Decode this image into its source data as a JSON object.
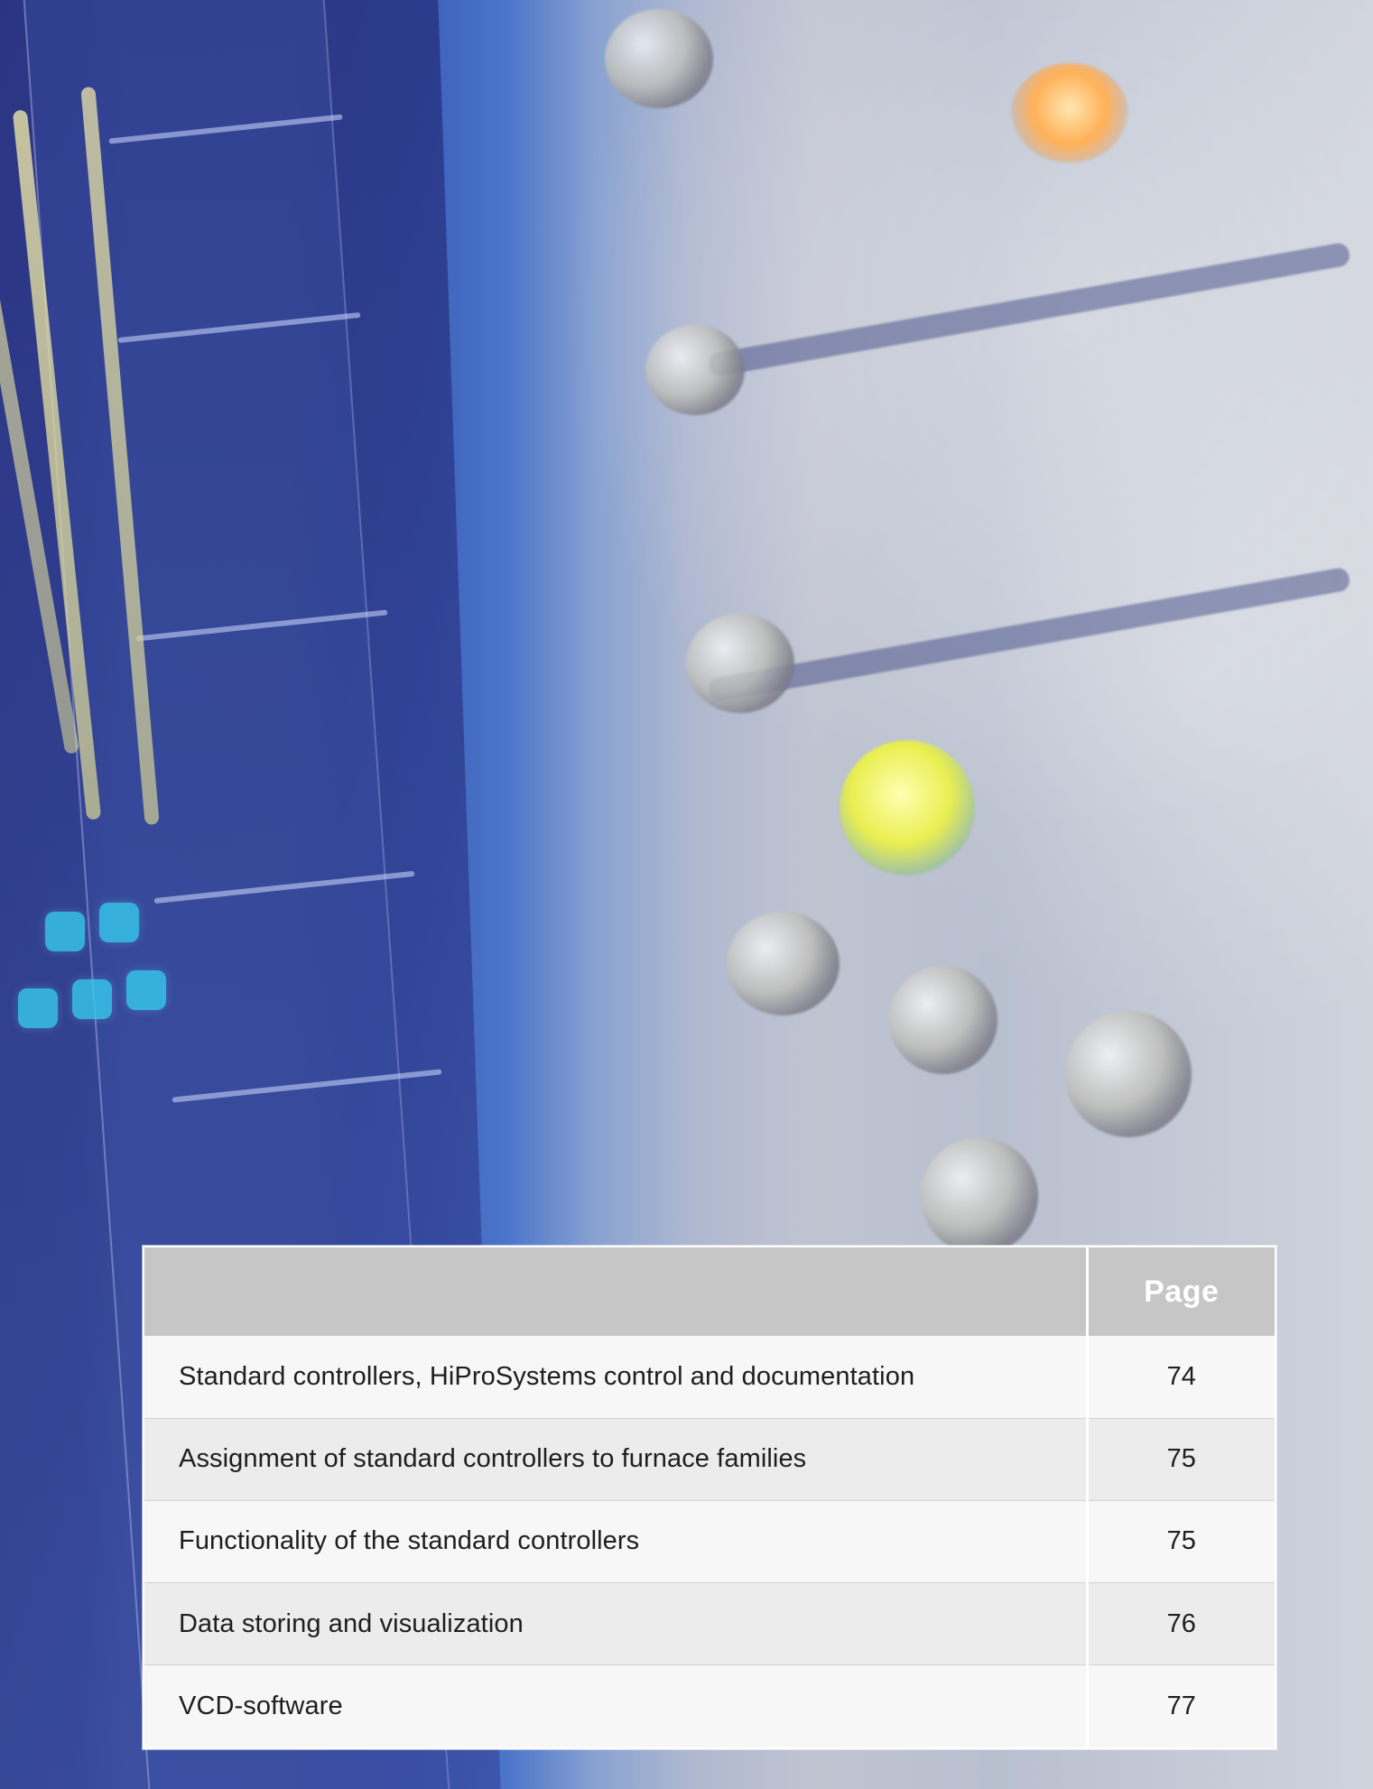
{
  "toc": {
    "header": {
      "page_label": "Page"
    },
    "rows": [
      {
        "title": "Standard controllers, HiProSystems control and documentation",
        "page": "74"
      },
      {
        "title": "Assignment of standard controllers to furnace families",
        "page": "75"
      },
      {
        "title": "Functionality of the standard controllers",
        "page": "75"
      },
      {
        "title": "Data storing and visualization",
        "page": "76"
      },
      {
        "title": "VCD-software",
        "page": "77"
      }
    ]
  },
  "colors": {
    "header_bg": "#c6c6c6",
    "row_light": "#f7f7f7",
    "row_alt": "#ececec",
    "text": "#1e1e1e",
    "background_blue": "#4b62a8"
  }
}
